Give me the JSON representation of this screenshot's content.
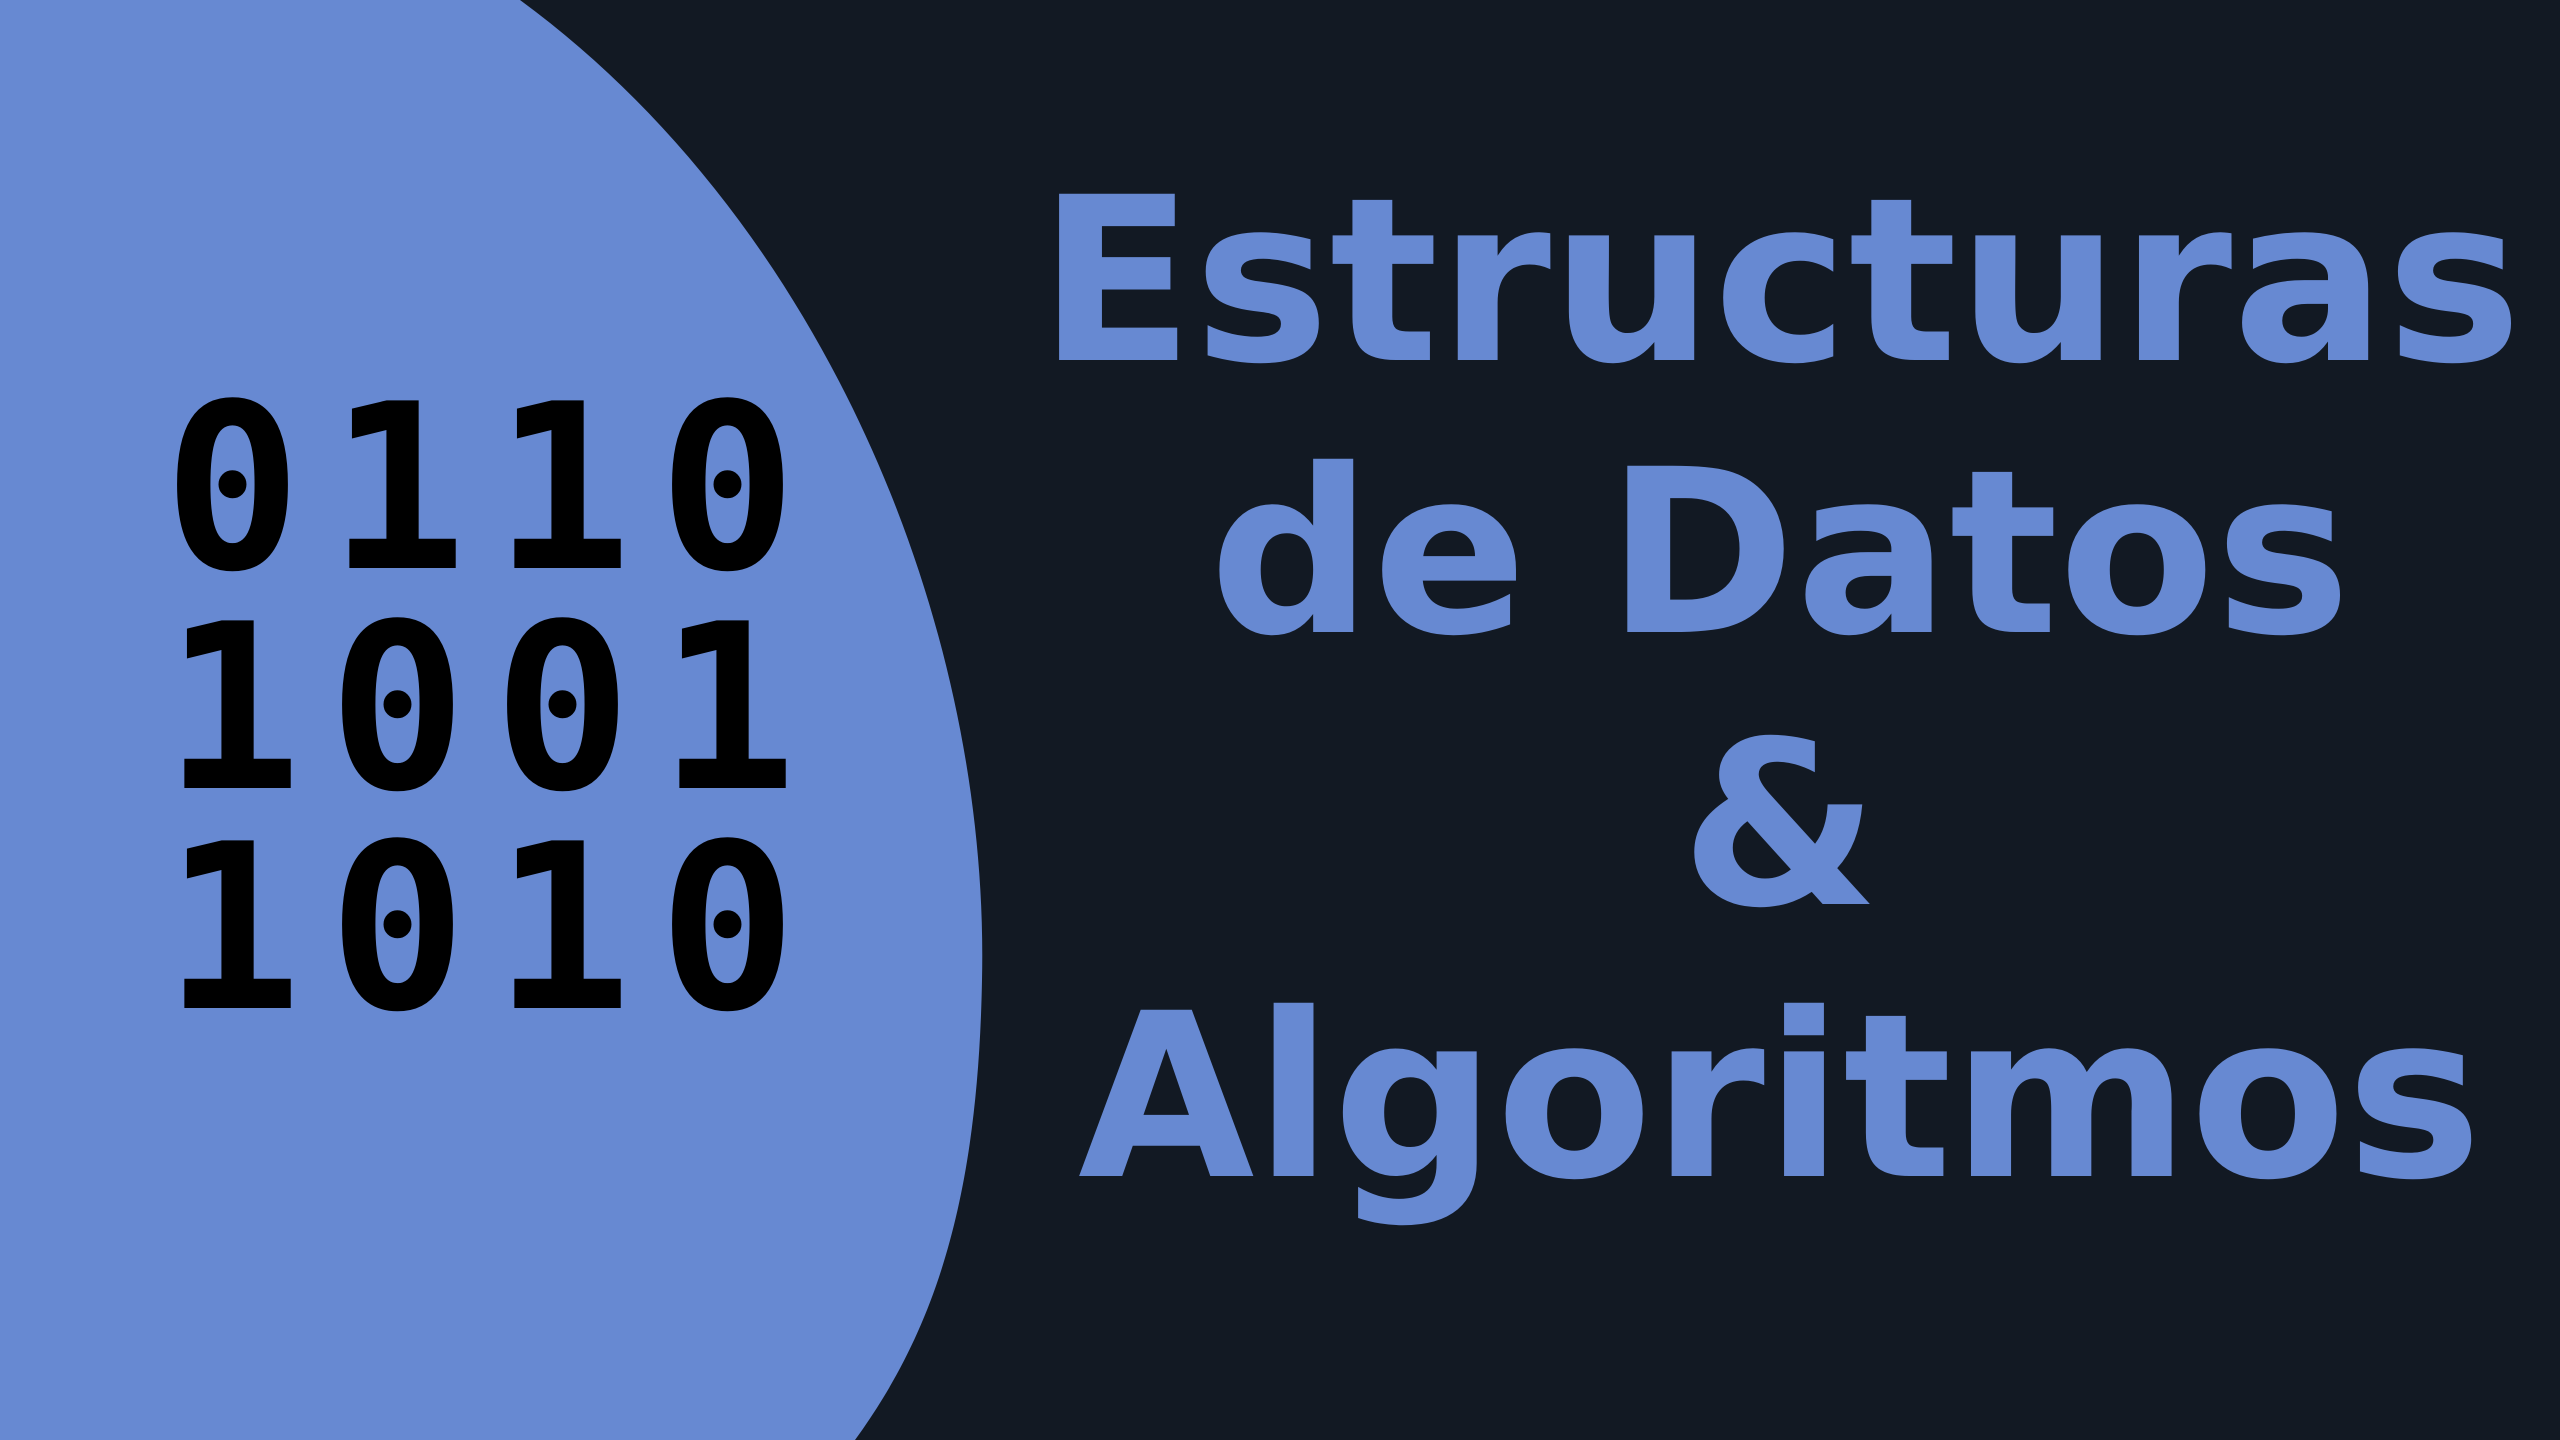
{
  "colors": {
    "background": "#121923",
    "accent": "#6789d2",
    "digits": "#000000"
  },
  "binary": {
    "rows": [
      "0110",
      "1001",
      "1010"
    ]
  },
  "title": {
    "line1": "Estructuras",
    "line2": "de Datos",
    "line3": "&",
    "line4": "Algoritmos"
  }
}
